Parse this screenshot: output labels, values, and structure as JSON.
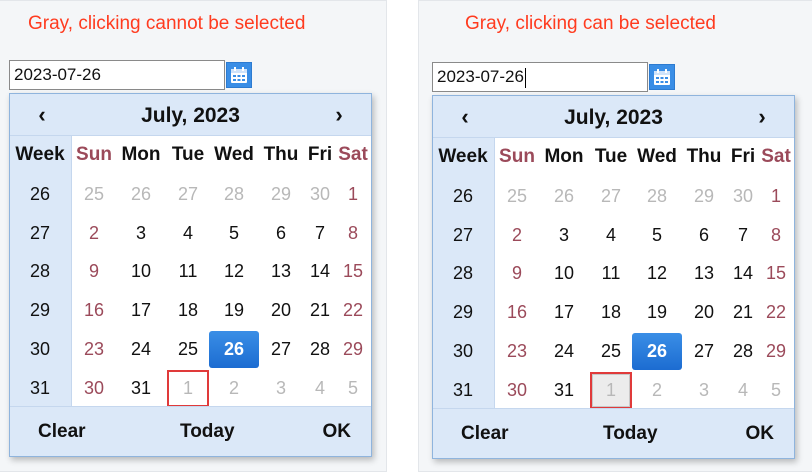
{
  "left": {
    "caption": "Gray, clicking cannot be selected",
    "input_value": "2023-07-26",
    "picker": {
      "title": "July, 2023",
      "prev": "‹",
      "next": "›",
      "week_header": "Week",
      "days": [
        "Sun",
        "Mon",
        "Tue",
        "Wed",
        "Thu",
        "Fri",
        "Sat"
      ],
      "weeks": [
        "26",
        "27",
        "28",
        "29",
        "30",
        "31"
      ],
      "rows": [
        [
          "25",
          "26",
          "27",
          "28",
          "29",
          "30",
          "1"
        ],
        [
          "2",
          "3",
          "4",
          "5",
          "6",
          "7",
          "8"
        ],
        [
          "9",
          "10",
          "11",
          "12",
          "13",
          "14",
          "15"
        ],
        [
          "16",
          "17",
          "18",
          "19",
          "20",
          "21",
          "22"
        ],
        [
          "23",
          "24",
          "25",
          "26",
          "27",
          "28",
          "29"
        ],
        [
          "30",
          "31",
          "1",
          "2",
          "3",
          "4",
          "5"
        ]
      ],
      "footer": {
        "clear": "Clear",
        "today": "Today",
        "ok": "OK"
      }
    }
  },
  "right": {
    "caption": "Gray, clicking can be selected",
    "input_value": "2023-07-26",
    "picker": {
      "title": "July, 2023",
      "prev": "‹",
      "next": "›",
      "week_header": "Week",
      "days": [
        "Sun",
        "Mon",
        "Tue",
        "Wed",
        "Thu",
        "Fri",
        "Sat"
      ],
      "weeks": [
        "26",
        "27",
        "28",
        "29",
        "30",
        "31"
      ],
      "rows": [
        [
          "25",
          "26",
          "27",
          "28",
          "29",
          "30",
          "1"
        ],
        [
          "2",
          "3",
          "4",
          "5",
          "6",
          "7",
          "8"
        ],
        [
          "9",
          "10",
          "11",
          "12",
          "13",
          "14",
          "15"
        ],
        [
          "16",
          "17",
          "18",
          "19",
          "20",
          "21",
          "22"
        ],
        [
          "23",
          "24",
          "25",
          "26",
          "27",
          "28",
          "29"
        ],
        [
          "30",
          "31",
          "1",
          "2",
          "3",
          "4",
          "5"
        ]
      ],
      "footer": {
        "clear": "Clear",
        "today": "Today",
        "ok": "OK"
      }
    }
  },
  "colors": {
    "caption": "#ff3b1f",
    "selected": "#1c6cd1",
    "weekend": "#9b4a5a",
    "outline": "#e03a3a"
  },
  "icons": [
    "calendar-icon"
  ]
}
